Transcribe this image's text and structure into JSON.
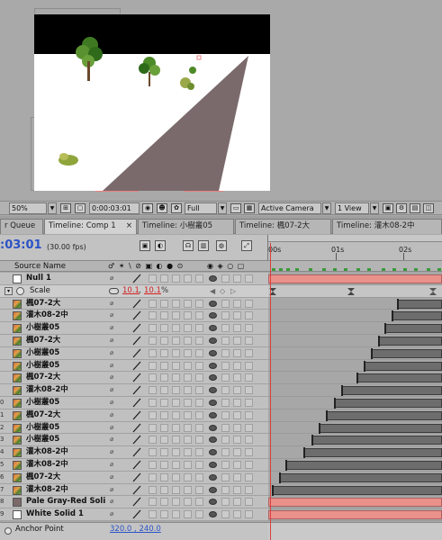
{
  "viewer": {
    "zoom": "50%",
    "timecode": "0:00:03:01",
    "resolution": "Full",
    "camera": "Active Camera",
    "view_layout": "1 View"
  },
  "tabs": [
    {
      "label": "r Queue"
    },
    {
      "label": "Timeline: Comp 1",
      "active": true,
      "close": "×"
    },
    {
      "label": "Timeline: 小樹叢05"
    },
    {
      "label": "Timeline: 楓07-2大"
    },
    {
      "label": "Timeline: 灌木08-2中"
    }
  ],
  "timeline": {
    "timecode": ":03:01",
    "fps": "(30.00 fps)",
    "ruler_labels": [
      "00s",
      "01s",
      "02s"
    ],
    "columns": {
      "source_name": "Source Name",
      "switches": "♂ ✶ \\ ⊘ ▣ ◐ ● ⊙",
      "av": "◉ ◈ ○ ▢"
    }
  },
  "layers": [
    {
      "num": "",
      "name": "Null 1",
      "type": "null",
      "bar": {
        "start": 0.0,
        "end": 1.0,
        "solid": true
      }
    },
    {
      "kind": "property",
      "name": "Scale",
      "value_x": "10.1",
      "value_y": "10.1",
      "unit": "%"
    },
    {
      "num": "",
      "name": "楓07-2大",
      "type": "footage",
      "bar": {
        "start": 0.74,
        "end": 1.0
      }
    },
    {
      "num": "",
      "name": "灌木08-2中",
      "type": "footage",
      "bar": {
        "start": 0.71,
        "end": 1.0
      }
    },
    {
      "num": "",
      "name": "小樹叢05",
      "type": "footage",
      "bar": {
        "start": 0.67,
        "end": 1.0
      }
    },
    {
      "num": "",
      "name": "楓07-2大",
      "type": "footage",
      "bar": {
        "start": 0.63,
        "end": 1.0
      }
    },
    {
      "num": "",
      "name": "小樹叢05",
      "type": "footage",
      "bar": {
        "start": 0.59,
        "end": 1.0
      }
    },
    {
      "num": "",
      "name": "小樹叢05",
      "type": "footage",
      "bar": {
        "start": 0.55,
        "end": 1.0
      }
    },
    {
      "num": "",
      "name": "楓07-2大",
      "type": "footage",
      "bar": {
        "start": 0.51,
        "end": 1.0
      }
    },
    {
      "num": "",
      "name": "灌木08-2中",
      "type": "footage",
      "bar": {
        "start": 0.42,
        "end": 1.0
      }
    },
    {
      "num": "0",
      "name": "小樹叢05",
      "type": "footage",
      "bar": {
        "start": 0.38,
        "end": 1.0
      }
    },
    {
      "num": "1",
      "name": "楓07-2大",
      "type": "footage",
      "bar": {
        "start": 0.33,
        "end": 1.0
      }
    },
    {
      "num": "2",
      "name": "小樹叢05",
      "type": "footage",
      "bar": {
        "start": 0.29,
        "end": 1.0
      }
    },
    {
      "num": "3",
      "name": "小樹叢05",
      "type": "footage",
      "bar": {
        "start": 0.25,
        "end": 1.0
      }
    },
    {
      "num": "4",
      "name": "灌木08-2中",
      "type": "footage",
      "bar": {
        "start": 0.2,
        "end": 1.0
      }
    },
    {
      "num": "5",
      "name": "灌木08-2中",
      "type": "footage",
      "bar": {
        "start": 0.1,
        "end": 1.0
      }
    },
    {
      "num": "6",
      "name": "楓07-2大",
      "type": "footage",
      "bar": {
        "start": 0.06,
        "end": 1.0
      }
    },
    {
      "num": "7",
      "name": "灌木08-2中",
      "type": "footage",
      "bar": {
        "start": 0.02,
        "end": 1.0
      }
    },
    {
      "num": "8",
      "name": "Pale Gray-Red Soli",
      "type": "solid-gray",
      "bar": {
        "start": 0.0,
        "end": 1.0,
        "solid": true
      }
    },
    {
      "num": "9",
      "name": "White Solid 1",
      "type": "solid-white",
      "bar": {
        "start": 0.0,
        "end": 1.0,
        "solid": true
      }
    }
  ],
  "anchor_point": {
    "label": "Anchor Point",
    "value": "320.0 , 240.0"
  },
  "colors": {
    "accent_blue": "#2a52c6",
    "value_red": "#d02020",
    "solid_bar": "#e9918a",
    "marker_green": "#3a9a3a"
  }
}
